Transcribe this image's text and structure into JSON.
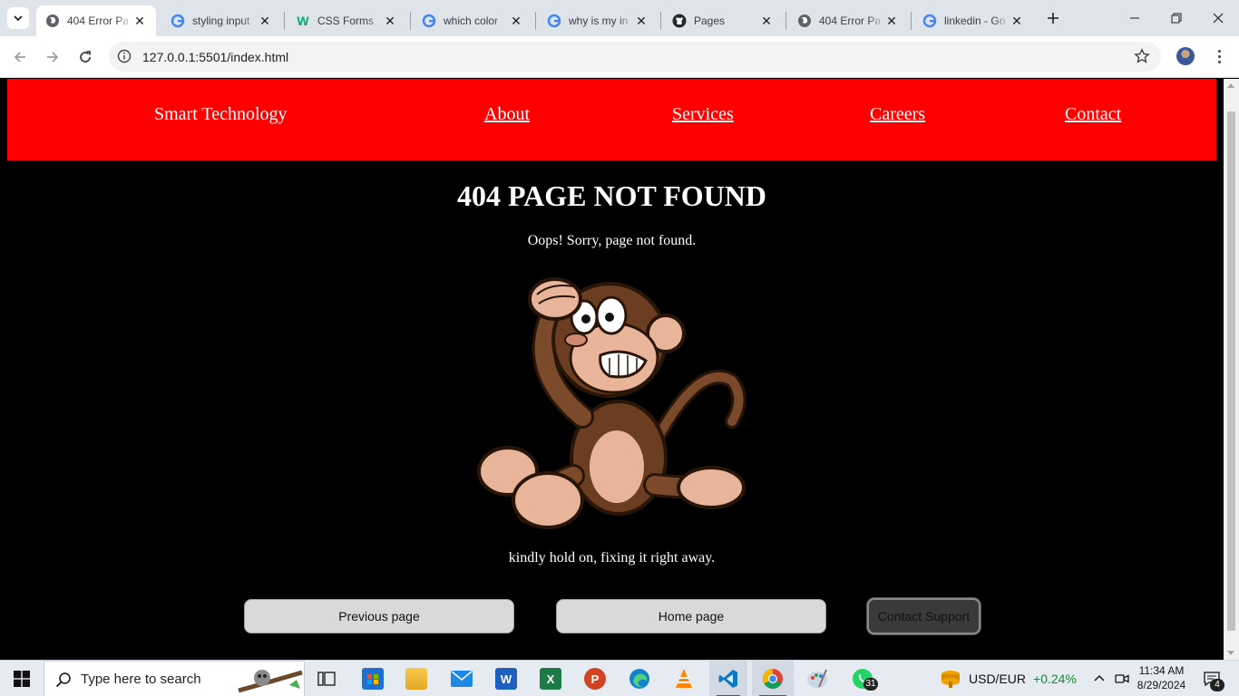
{
  "browser": {
    "tabs": [
      {
        "title": "404 Error Pa",
        "active": true,
        "favicon": "globe-icon"
      },
      {
        "title": "styling input",
        "active": false,
        "favicon": "google-icon"
      },
      {
        "title": "CSS Forms",
        "active": false,
        "favicon": "w3schools-icon"
      },
      {
        "title": "which color",
        "active": false,
        "favicon": "google-icon"
      },
      {
        "title": "why is my in",
        "active": false,
        "favicon": "google-icon"
      },
      {
        "title": "Pages",
        "active": false,
        "favicon": "github-icon"
      },
      {
        "title": "404 Error Pa",
        "active": false,
        "favicon": "globe-icon"
      },
      {
        "title": "linkedin - Go",
        "active": false,
        "favicon": "google-icon"
      }
    ],
    "url": "127.0.0.1:5501/index.html"
  },
  "page": {
    "brand": "Smart Technology",
    "nav": [
      {
        "label": "About"
      },
      {
        "label": "Services"
      },
      {
        "label": "Careers"
      },
      {
        "label": "Contact"
      }
    ],
    "heading": "404 PAGE NOT FOUND",
    "subtitle": "Oops! Sorry, page not found.",
    "illustration": "confused-monkey-illustration",
    "message": "kindly hold on, fixing it right away.",
    "buttons": {
      "previous": "Previous page",
      "home": "Home page",
      "support": "Contact Support"
    },
    "colors": {
      "nav_bg": "#ff0000",
      "page_bg": "#000000",
      "button_bg": "#d9d9d9",
      "support_bg": "#3a3a3a"
    }
  },
  "taskbar": {
    "search_placeholder": "Type here to search",
    "apps": [
      "task-view-icon",
      "microsoft-store-icon",
      "file-explorer-icon",
      "mail-icon",
      "word-icon",
      "excel-icon",
      "powerpoint-icon",
      "edge-icon",
      "vlc-icon",
      "vscode-icon",
      "chrome-icon",
      "paint-icon",
      "whatsapp-icon"
    ],
    "whatsapp_badge": "31",
    "ticker_symbol": "USD/EUR",
    "ticker_change": "+0.24%",
    "time": "11:34 AM",
    "date": "8/29/2024",
    "notification_count": "4"
  }
}
